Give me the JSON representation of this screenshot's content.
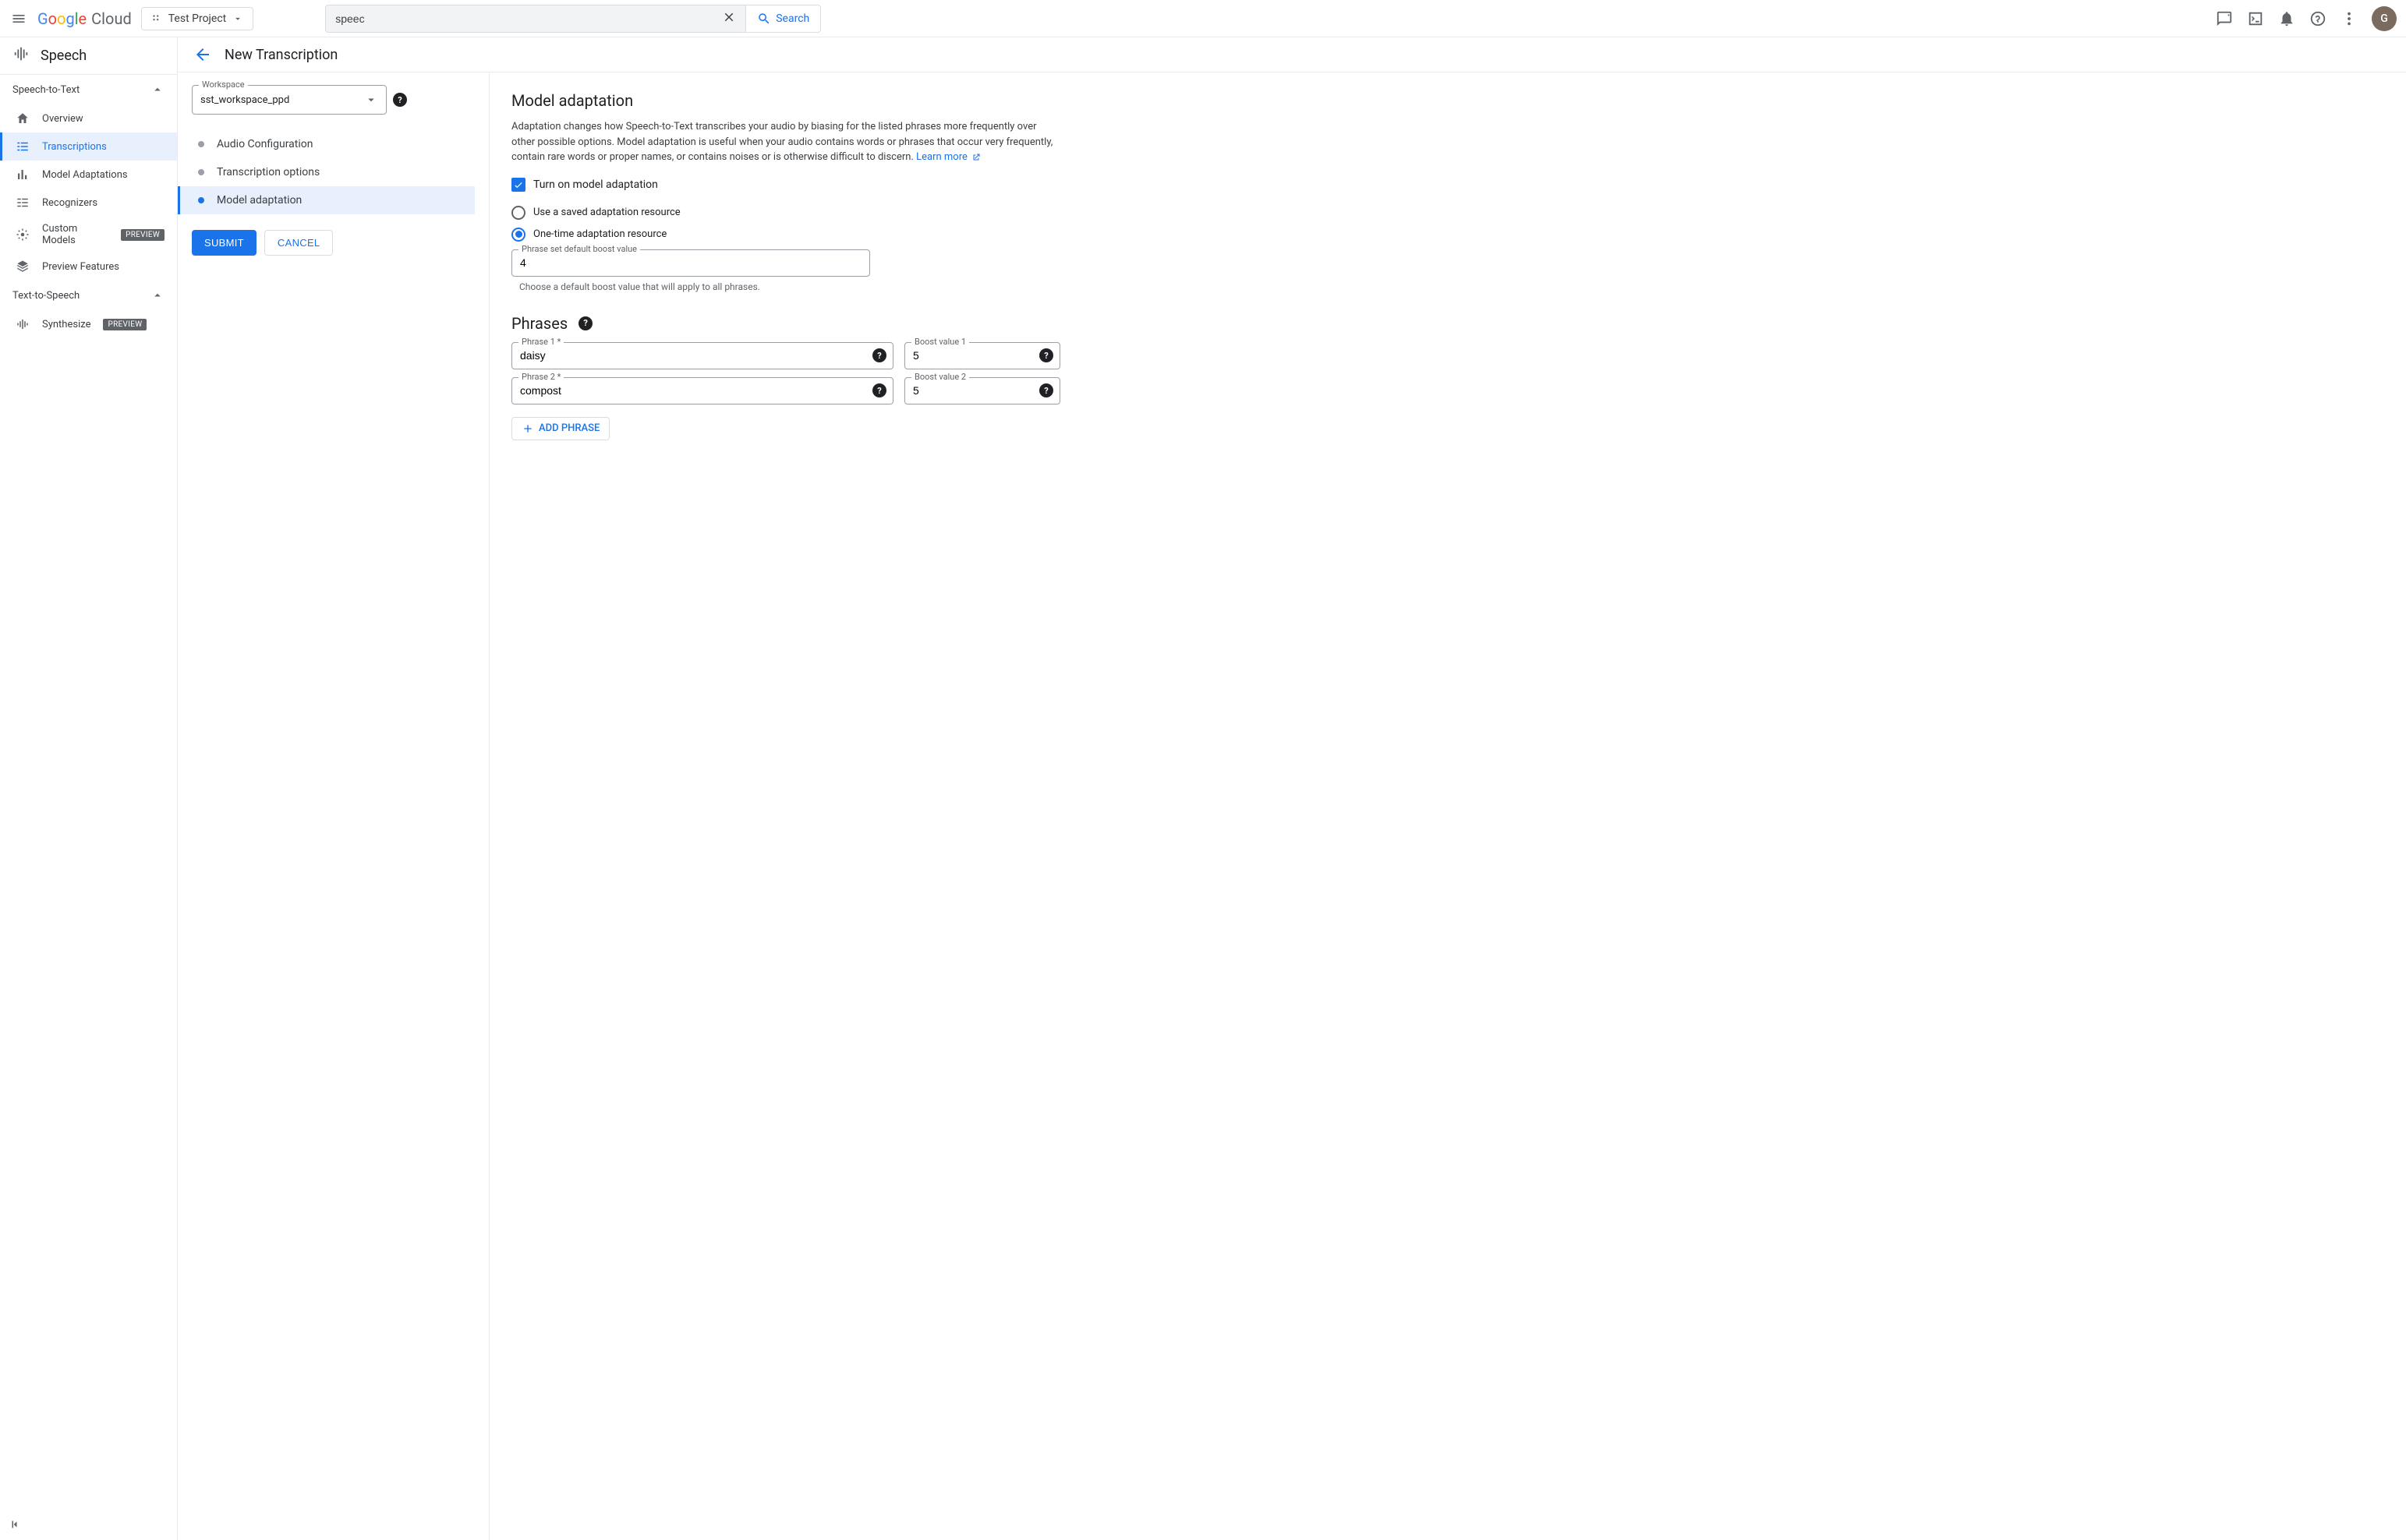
{
  "topbar": {
    "project_label": "Test Project",
    "search_value": "speec",
    "search_button": "Search",
    "avatar_letter": "G"
  },
  "sidebar": {
    "product": "Speech",
    "sections": [
      {
        "title": "Speech-to-Text",
        "items": [
          {
            "label": "Overview"
          },
          {
            "label": "Transcriptions",
            "active": true
          },
          {
            "label": "Model Adaptations"
          },
          {
            "label": "Recognizers"
          },
          {
            "label": "Custom Models",
            "badge": "PREVIEW"
          },
          {
            "label": "Preview Features"
          }
        ]
      },
      {
        "title": "Text-to-Speech",
        "items": [
          {
            "label": "Synthesize",
            "badge": "PREVIEW"
          }
        ]
      }
    ]
  },
  "page": {
    "title": "New Transcription",
    "workspace_label": "Workspace",
    "workspace_value": "sst_workspace_ppd",
    "steps": [
      {
        "label": "Audio Configuration"
      },
      {
        "label": "Transcription options"
      },
      {
        "label": "Model adaptation",
        "active": true
      }
    ],
    "submit": "SUBMIT",
    "cancel": "CANCEL"
  },
  "adaptation": {
    "heading": "Model adaptation",
    "description": "Adaptation changes how Speech-to-Text transcribes your audio by biasing for the listed phrases more frequently over other possible options. Model adaptation is useful when your audio contains words or phrases that occur very frequently, contain rare words or proper names, or contains noises or is otherwise difficult to discern. ",
    "learn_more": "Learn more",
    "enable_label": "Turn on model adaptation",
    "radio_saved": "Use a saved adaptation resource",
    "radio_onetime": "One-time adaptation resource",
    "boost_label": "Phrase set default boost value",
    "boost_value": "4",
    "boost_hint": "Choose a default boost value that will apply to all phrases.",
    "phrases_heading": "Phrases",
    "phrases": [
      {
        "phrase_label": "Phrase 1 *",
        "phrase_value": "daisy",
        "boost_label": "Boost value 1",
        "boost_value": "5"
      },
      {
        "phrase_label": "Phrase 2 *",
        "phrase_value": "compost",
        "boost_label": "Boost value 2",
        "boost_value": "5"
      }
    ],
    "add_phrase": "ADD PHRASE"
  }
}
